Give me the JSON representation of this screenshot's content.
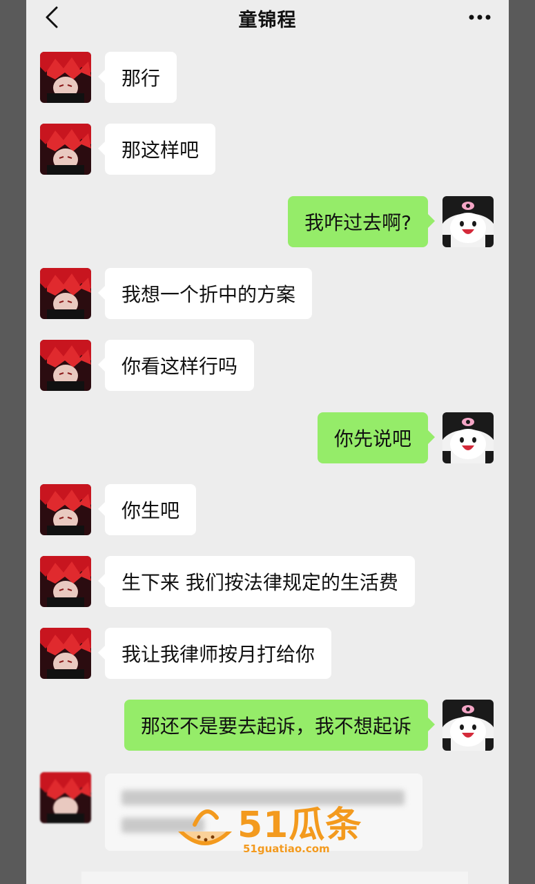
{
  "header": {
    "title": "童锦程",
    "back_icon": "chevron-left-icon",
    "more_icon": "more-dots-icon"
  },
  "messages": [
    {
      "side": "left",
      "text": "那行"
    },
    {
      "side": "left",
      "text": "那这样吧"
    },
    {
      "side": "right",
      "text": "我咋过去啊?"
    },
    {
      "side": "left",
      "text": "我想一个折中的方案"
    },
    {
      "side": "left",
      "text": "你看这样行吗"
    },
    {
      "side": "right",
      "text": "你先说吧"
    },
    {
      "side": "left",
      "text": "你生吧"
    },
    {
      "side": "left",
      "text": "生下来 我们按法律规定的生活费"
    },
    {
      "side": "left",
      "text": "我让我律师按月打给你"
    },
    {
      "side": "right",
      "text": "那还不是要去起诉，我不想起诉"
    }
  ],
  "watermark": {
    "brand": "51瓜条",
    "url": "51guatiao.com"
  },
  "colors": {
    "background": "#ededed",
    "incoming_bubble": "#ffffff",
    "outgoing_bubble": "#95ec69",
    "watermark": "#f39a1e"
  }
}
